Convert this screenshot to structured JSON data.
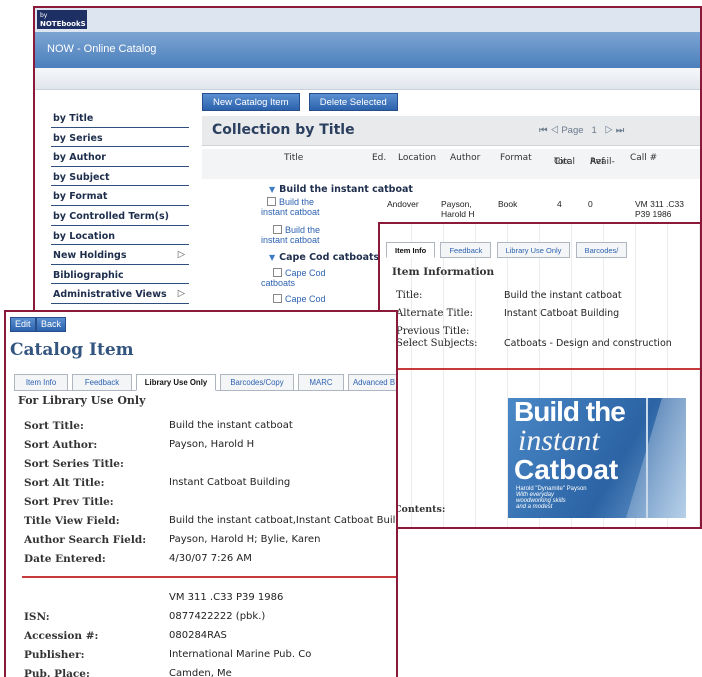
{
  "app": {
    "logo_small": "by",
    "logo_main": "NOTEbookS",
    "title": "NOW - Online Catalog"
  },
  "sidebar": {
    "items": [
      {
        "label": "by Title",
        "arrow": ""
      },
      {
        "label": "by Series",
        "arrow": ""
      },
      {
        "label": "by Author",
        "arrow": ""
      },
      {
        "label": "by Subject",
        "arrow": ""
      },
      {
        "label": "by Format",
        "arrow": ""
      },
      {
        "label": "by Controlled Term(s)",
        "arrow": ""
      },
      {
        "label": "by Location",
        "arrow": ""
      },
      {
        "label": "New Holdings",
        "arrow": "▷"
      },
      {
        "label": "Bibliographic",
        "arrow": ""
      },
      {
        "label": "Administrative Views",
        "arrow": "▷"
      }
    ]
  },
  "toolbar": {
    "new_item": "New Catalog Item",
    "delete_selected": "Delete Selected"
  },
  "collection": {
    "title": "Collection by Title",
    "pager_first": "⏮",
    "pager_prev": "◁",
    "pager_label": "Page",
    "page_number": "1",
    "pager_next": "▷",
    "pager_last": "⏭",
    "columns": {
      "title": "Title",
      "ed": "Ed.",
      "location": "Location",
      "author": "Author",
      "format": "Format",
      "total_circ_1": "Total",
      "total_circ_2": "Circ",
      "avail_ref_1": "Avail-",
      "avail_ref_2": "Ref",
      "call": "Call #"
    },
    "group1": {
      "name": "Build the instant catboat",
      "row1": {
        "title_1": "Build the",
        "title_2": "instant catboat",
        "location": "Andover",
        "author_1": "Payson,",
        "author_2": "Harold H",
        "format": "Book",
        "total_circ": "4",
        "avail_ref": "0",
        "call_1": "VM 311 .C33",
        "call_2": "P39 1986"
      },
      "row2": {
        "title_1": "Build the",
        "title_2": "instant catboat"
      }
    },
    "group2": {
      "name": "Cape Cod catboats",
      "row1": {
        "title_1": "Cape Cod",
        "title_2": "catboats"
      },
      "row2": {
        "title_1": "Cape Cod"
      }
    }
  },
  "item_info": {
    "tabs": [
      "Item Info",
      "Feedback",
      "Library Use Only",
      "Barcodes/"
    ],
    "heading": "Item Information",
    "fields": {
      "title_label": "Title:",
      "title_value": "Build the instant catboat",
      "alt_label": "Alternate Title:",
      "alt_value": "Instant Catboat Building",
      "prev_label": "Previous Title:",
      "subjects_label": "Select Subjects:",
      "subjects_value": "Catboats - Design and construction"
    },
    "cover": {
      "line1": "Build the",
      "line2": "instant",
      "line3": "Catboat",
      "author": "Harold \"Dynamite\" Payson",
      "blurb": "With everyday woodworking skills and a modest"
    },
    "contents_label": "Contents:"
  },
  "catalog_item": {
    "edit": "Edit",
    "back": "Back",
    "title": "Catalog Item",
    "tabs": [
      "Item Info",
      "Feedback",
      "Library Use Only",
      "Barcodes/Copy",
      "MARC",
      "Advanced B"
    ],
    "section": "For Library Use Only",
    "rows": [
      {
        "label": "Sort Title:",
        "value": "Build the instant catboat"
      },
      {
        "label": "Sort Author:",
        "value": "Payson, Harold H"
      },
      {
        "label": "Sort Series Title:",
        "value": ""
      },
      {
        "label": "Sort Alt Title:",
        "value": "Instant Catboat Building"
      },
      {
        "label": "Sort Prev Title:",
        "value": ""
      },
      {
        "label": "Title View Field:",
        "value": "Build the instant catboat,Instant Catboat Building"
      },
      {
        "label": "Author Search Field:",
        "value": "Payson, Harold H; Bylie, Karen"
      },
      {
        "label": "Date Entered:",
        "value": "4/30/07 7:26 AM"
      }
    ],
    "call_number": "VM 311 .C33 P39 1986",
    "rows2": [
      {
        "label": "ISN:",
        "value": "0877422222 (pbk.)"
      },
      {
        "label": "Accession #:",
        "value": "080284RAS"
      },
      {
        "label": "Publisher:",
        "value": "International Marine Pub. Co"
      },
      {
        "label": "Pub. Place:",
        "value": "Camden, Me"
      }
    ]
  }
}
